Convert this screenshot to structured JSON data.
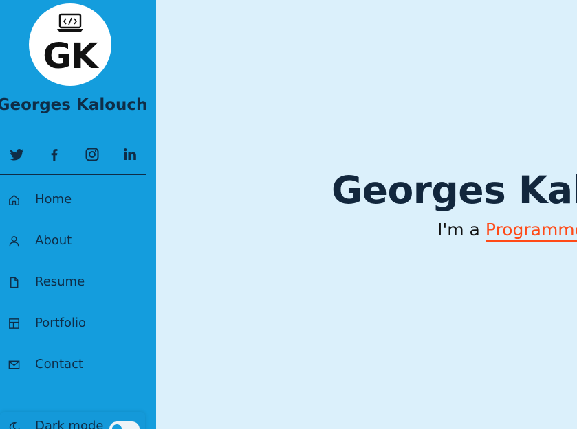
{
  "profile": {
    "logo_text": "GK",
    "name": "Georges Kalouch"
  },
  "socials": [
    {
      "icon": "twitter-icon"
    },
    {
      "icon": "facebook-icon"
    },
    {
      "icon": "instagram-icon"
    },
    {
      "icon": "linkedin-icon"
    }
  ],
  "nav": {
    "items": [
      {
        "label": "Home",
        "icon": "home-icon"
      },
      {
        "label": "About",
        "icon": "user-icon"
      },
      {
        "label": "Resume",
        "icon": "file-icon"
      },
      {
        "label": "Portfolio",
        "icon": "layout-icon"
      },
      {
        "label": "Contact",
        "icon": "envelope-icon"
      }
    ]
  },
  "darkmode": {
    "label": "Dark mode",
    "enabled": false
  },
  "hero": {
    "title": "Georges Kalouch",
    "prefix": "I'm a ",
    "typed": "Programmer"
  },
  "colors": {
    "sidebar": "#149ddd",
    "background": "#dbf0fb",
    "text_dark": "#0f2d47",
    "accent": "#ff4a17"
  }
}
